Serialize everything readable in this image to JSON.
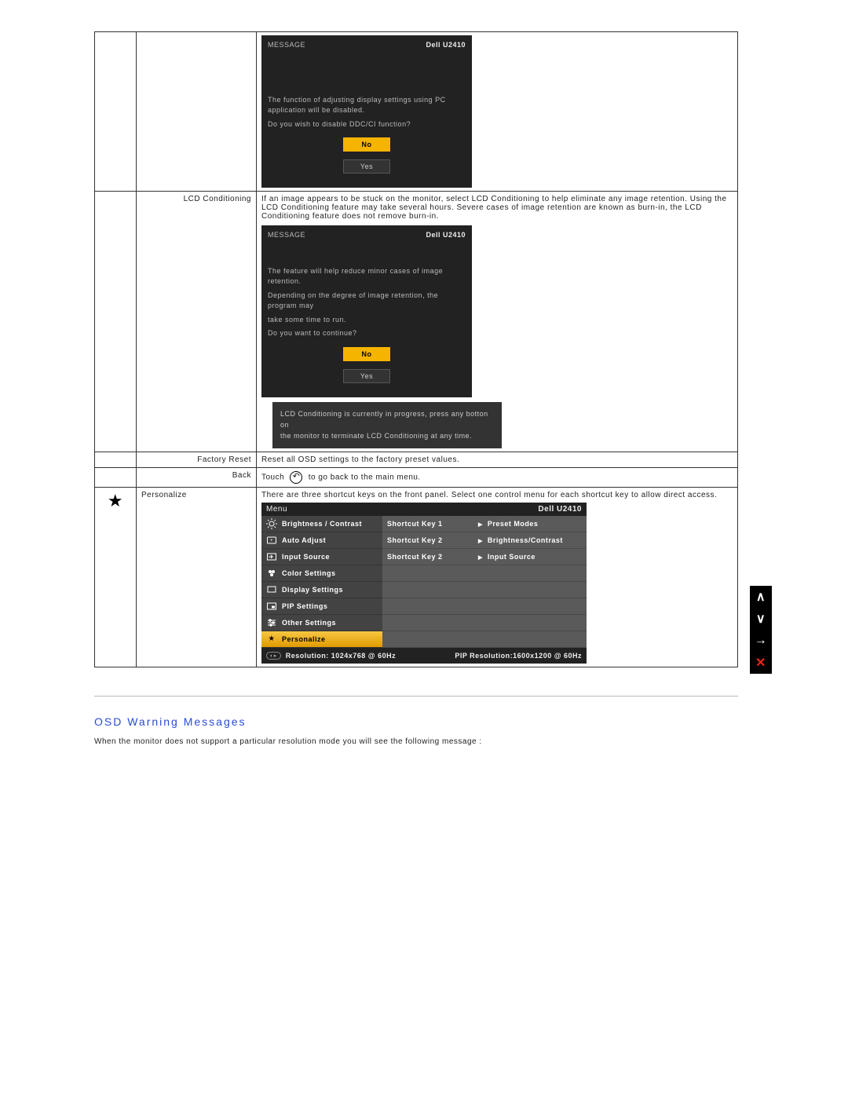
{
  "model": "Dell U2410",
  "dialog1": {
    "header": "MESSAGE",
    "line1": "The function of adjusting display settings using PC application will be disabled.",
    "line2": "Do you wish to disable DDC/CI function?",
    "btn_no": "No",
    "btn_yes": "Yes"
  },
  "row_lcd": {
    "label": "LCD Conditioning",
    "text": "If an image appears to be stuck on the monitor, select LCD Conditioning to help eliminate any image retention. Using the LCD Conditioning feature may take several hours. Severe cases of image retention are known as burn-in, the LCD Conditioning feature does not remove burn-in."
  },
  "dialog2": {
    "header": "MESSAGE",
    "line1": "The feature will help reduce minor cases of image retention.",
    "line2": "Depending on the degree of image retention, the program may",
    "line3": "take some time to run.",
    "line4": "Do you want to continue?",
    "btn_no": "No",
    "btn_yes": "Yes"
  },
  "progress_bar": {
    "line1": "LCD Conditioning is currently in progress, press any botton on",
    "line2": "the monitor to terminate LCD Conditioning at any time."
  },
  "row_factory": {
    "label": "Factory Reset",
    "text": "Reset all OSD settings to the factory preset values."
  },
  "row_back": {
    "label": "Back",
    "pre": "Touch",
    "post": "to go back to the main menu."
  },
  "row_personalize": {
    "label": "Personalize",
    "text": "There are three shortcut keys on the front panel. Select one control menu for each shortcut key to allow direct access."
  },
  "menu": {
    "title": "Menu",
    "items": [
      "Brightness / Contrast",
      "Auto Adjust",
      "Input Source",
      "Color Settings",
      "Display Settings",
      "PIP Settings",
      "Other Settings",
      "Personalize"
    ],
    "shortcuts": [
      {
        "k": "Shortcut Key 1",
        "v": "Preset Modes"
      },
      {
        "k": "Shortcut Key 2",
        "v": "Brightness/Contrast"
      },
      {
        "k": "Shortcut Key 2",
        "v": "Input Source"
      }
    ],
    "foot_pill": "◐▸",
    "resolution": "Resolution: 1024x768 @ 60Hz",
    "pip": "PIP Resolution:1600x1200 @ 60Hz"
  },
  "section_title": "OSD Warning Messages",
  "section_text": "When the monitor does not support a particular resolution mode you will see the following message :"
}
